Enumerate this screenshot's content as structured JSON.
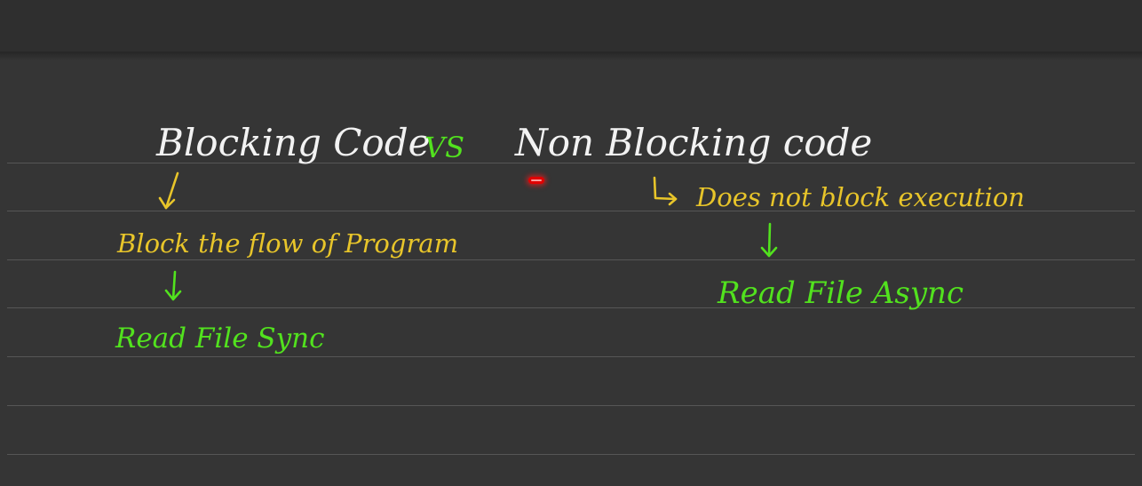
{
  "heading": {
    "left": "Blocking Code",
    "vs": "VS",
    "right": "Non Blocking code"
  },
  "blocking": {
    "description": "Block the flow of Program",
    "example": "Read File Sync"
  },
  "non_blocking": {
    "description": "Does not block execution",
    "example": "Read File Async"
  },
  "colors": {
    "background": "#353535",
    "heading": "#f2f2f2",
    "description": "#e8c52a",
    "example": "#52e21e",
    "pointer": "#e00000"
  }
}
